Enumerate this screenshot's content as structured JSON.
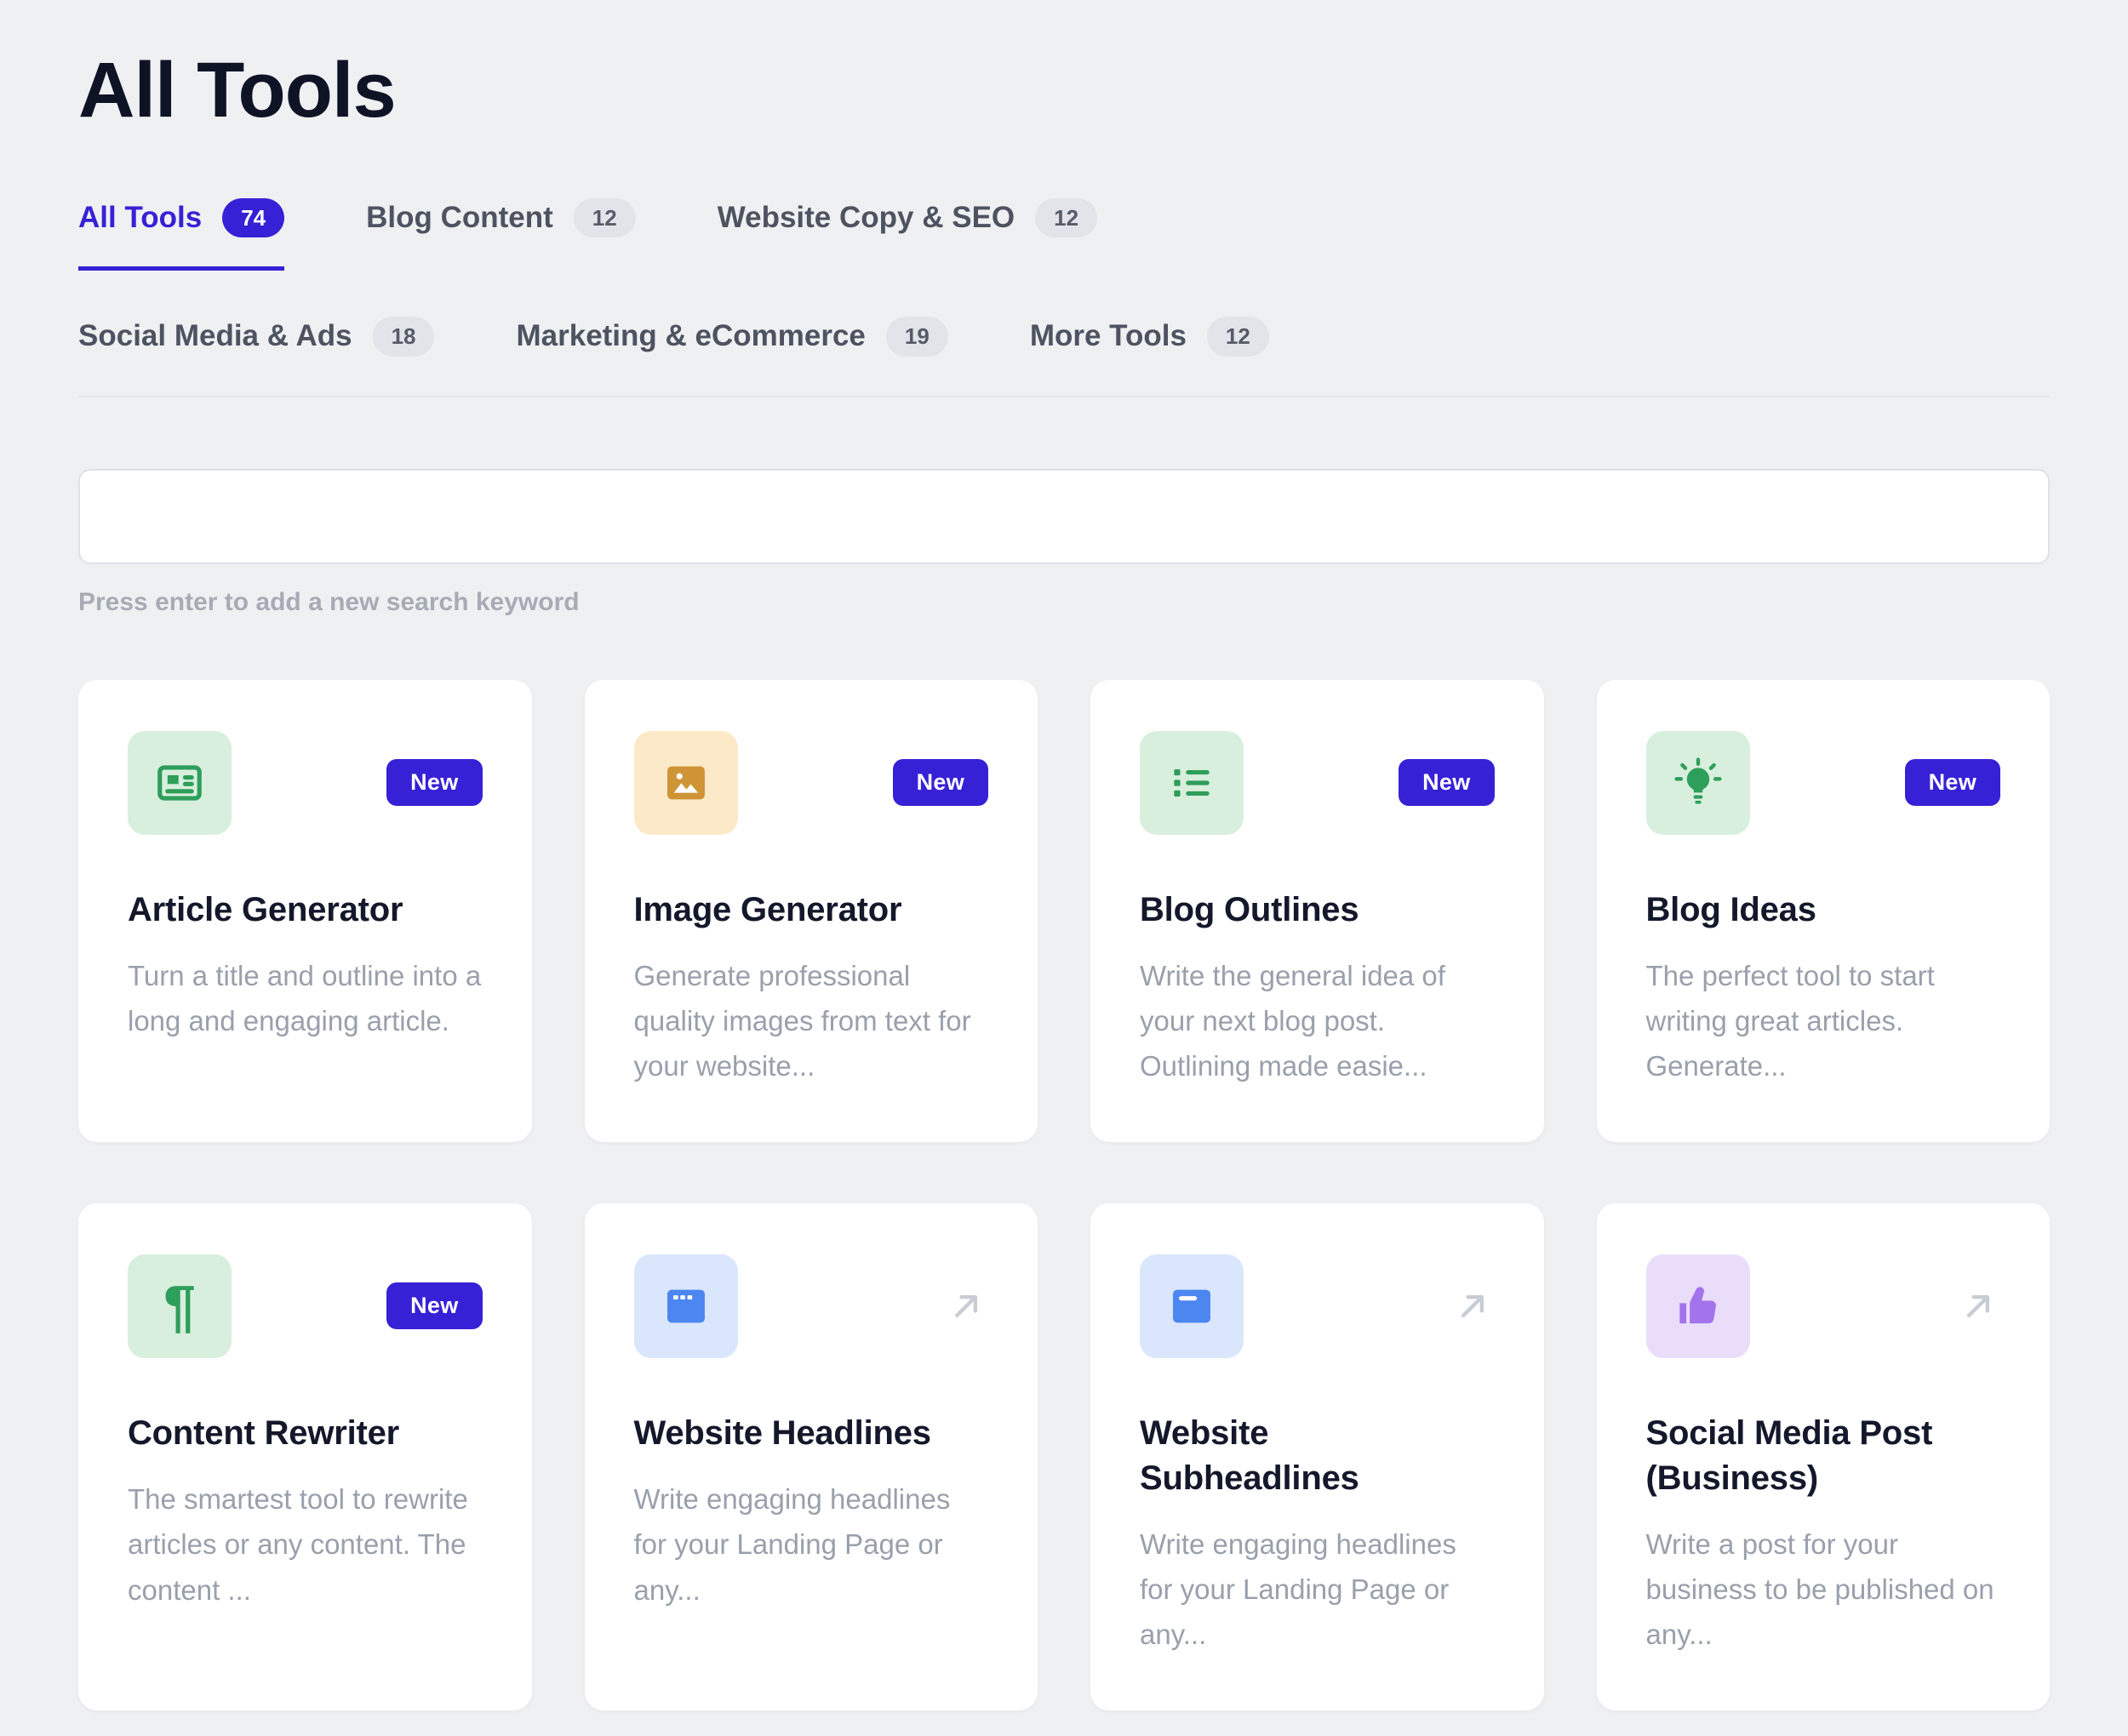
{
  "page": {
    "title": "All Tools"
  },
  "tabs": {
    "row1": [
      {
        "label": "All Tools",
        "count": "74",
        "active": true
      },
      {
        "label": "Blog Content",
        "count": "12",
        "active": false
      },
      {
        "label": "Website Copy & SEO",
        "count": "12",
        "active": false
      }
    ],
    "row2": [
      {
        "label": "Social Media & Ads",
        "count": "18",
        "active": false
      },
      {
        "label": "Marketing & eCommerce",
        "count": "19",
        "active": false
      },
      {
        "label": "More Tools",
        "count": "12",
        "active": false
      }
    ]
  },
  "search": {
    "value": "",
    "placeholder": "",
    "helper_text": "Press enter to add a new search keyword"
  },
  "cards": [
    {
      "title": "Article Generator",
      "description": "Turn a title and outline into a long and engaging article.",
      "badge": "New",
      "icon": "newspaper-icon",
      "tile_color": "green"
    },
    {
      "title": "Image Generator",
      "description": "Generate professional quality images from text for your website...",
      "badge": "New",
      "icon": "image-icon",
      "tile_color": "yellow"
    },
    {
      "title": "Blog Outlines",
      "description": "Write the general idea of your next blog post. Outlining made easie...",
      "badge": "New",
      "icon": "list-icon",
      "tile_color": "green"
    },
    {
      "title": "Blog Ideas",
      "description": "The perfect tool to start writing great articles. Generate...",
      "badge": "New",
      "icon": "lightbulb-icon",
      "tile_color": "green"
    },
    {
      "title": "Content Rewriter",
      "description": "The smartest tool to rewrite articles or any content. The content ...",
      "badge": "New",
      "icon": "pilcrow-icon",
      "tile_color": "green"
    },
    {
      "title": "Website Headlines",
      "description": "Write engaging headlines for your Landing Page or any...",
      "badge": null,
      "icon": "browser-icon",
      "tile_color": "blue"
    },
    {
      "title": "Website Subheadlines",
      "description": "Write engaging headlines for your Landing Page or any...",
      "badge": null,
      "icon": "browser-bar-icon",
      "tile_color": "blue"
    },
    {
      "title": "Social Media Post (Business)",
      "description": "Write a post for your business to be published on any...",
      "badge": null,
      "icon": "thumbs-up-icon",
      "tile_color": "purple"
    }
  ],
  "theme": {
    "accent": "#3621d6",
    "page_bg": "#eff0f2",
    "card_bg": "#ffffff",
    "title_color": "#0f1326",
    "muted_text": "#99a0ab",
    "tab_inactive": "#4d5361",
    "pill_bg": "#e3e4e9",
    "pill_text": "#555b68",
    "border_color": "#e3e4e8",
    "arrow_color": "#c8ccd4",
    "tile_green_bg": "#d8efdd",
    "tile_green_fg": "#2e9e5b",
    "tile_yellow_bg": "#fbe9c8",
    "tile_yellow_fg": "#cf9435",
    "tile_blue_bg": "#d9e6fb",
    "tile_blue_fg": "#4c86f0",
    "tile_purple_bg": "#e9ddf9",
    "tile_purple_fg": "#a273ec"
  }
}
